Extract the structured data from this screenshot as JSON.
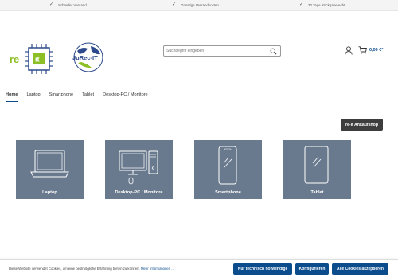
{
  "topbar": {
    "usps": [
      "Schneller Versand",
      "Günstige Versandkosten",
      "30 Tage Rückgaberecht"
    ]
  },
  "logos": {
    "primary_text": "re-it",
    "secondary_text": "JuRec-IT"
  },
  "search": {
    "placeholder": "Suchbegriff eingeben"
  },
  "header": {
    "cart_total": "0,00 €*"
  },
  "nav": {
    "items": [
      "Home",
      "Laptop",
      "Smartphone",
      "Tablet",
      "Desktop-PC / Monitore"
    ]
  },
  "buyback_button": "re-it Ankaufshop",
  "categories": [
    {
      "label": "Laptop",
      "icon": "laptop-icon"
    },
    {
      "label": "Desktop-PC / Monitore",
      "icon": "desktop-pc-icon"
    },
    {
      "label": "Smartphone",
      "icon": "smartphone-icon"
    },
    {
      "label": "Tablet",
      "icon": "tablet-icon"
    }
  ],
  "cookie": {
    "text": "Diese Website verwendet Cookies, um eine bestmögliche Erfahrung bieten zu können.",
    "more_link": "Mehr Informationen ...",
    "buttons": [
      "Nur technisch notwendige",
      "Konfigurieren",
      "Alle Cookies akzeptieren"
    ]
  },
  "colors": {
    "brand_blue": "#0a4c8c",
    "tile_bg": "#6a7a8e",
    "logo_green": "#8cbf26"
  }
}
